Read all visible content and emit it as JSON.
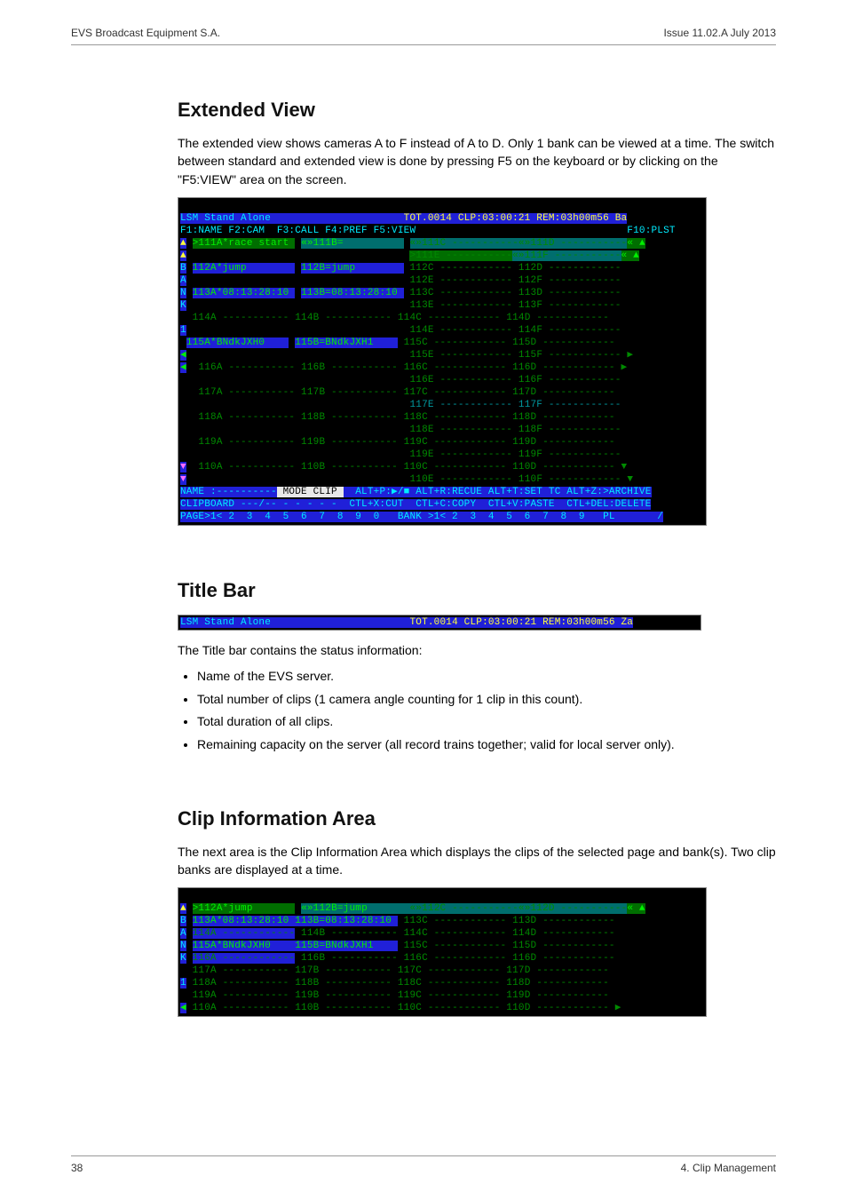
{
  "header": {
    "left": "EVS Broadcast Equipment S.A.",
    "right": "Issue 11.02.A July 2013"
  },
  "section1": {
    "title": "Extended View",
    "para": "The extended view shows cameras A to F instead of A to D. Only 1 bank can be viewed at a time. The switch between standard and extended view is done by pressing F5 on the keyboard or by clicking on the \"F5:VIEW\" area on the screen."
  },
  "terminal1": {
    "l1_left": "LSM Stand Alone",
    "l1_right": "TOT.0014 CLP:03:00:21 REM:03h00m56 Ba",
    "l2_left": "F1:NAME F2:CAM  F3:CALL F4:PREF F5:VIEW",
    "l2_right": "F10:PLST",
    "gutter": [
      "▲",
      "▲",
      "B",
      "A",
      "N",
      "K",
      "",
      "1",
      "",
      "◀",
      "◀",
      "",
      "",
      "",
      "",
      "",
      "",
      "",
      "▼",
      "▼"
    ],
    "row1": {
      "a": ">111A*race start ",
      "b": "«»111B=          ",
      "c": "«»111C -----------",
      "d": "«»111D -----------",
      "tail": "« ▲"
    },
    "row1b": {
      "a": "                 ",
      "b": "                 ",
      "c": ">111E -----------",
      "d": "«»111F -----------",
      "tail": "« ▲"
    },
    "r2": {
      "a": "112A*jump        ",
      "b": "112B=jump        ",
      "c": "112C ------------",
      "d": " 112D ------------"
    },
    "r2b": {
      "a": "                 ",
      "b": "                 ",
      "c": "112E ------------",
      "d": " 112F ------------"
    },
    "r3": {
      "a": "113A*08:13:28:10 ",
      "b": "113B=08:13:28:10 ",
      "c": "113C ------------",
      "d": " 113D ------------"
    },
    "r3b": {
      "a": "                 ",
      "b": "                 ",
      "c": "113E ------------",
      "d": " 113F ------------"
    },
    "r4": {
      "a": " 114A -----------",
      "b": " 114B -----------",
      "c": " 114C ------------",
      "d": " 114D ------------"
    },
    "r4b": {
      "a": "                 ",
      "b": "                 ",
      "c": " 114E ------------",
      "d": " 114F ------------"
    },
    "r5": {
      "a": "115A*BNdkJXH0    ",
      "b": "115B=BNdkJXH1    ",
      "c": " 115C ------------",
      "d": " 115D ------------"
    },
    "r5b": {
      "a": "                 ",
      "b": "                 ",
      "c": " 115E ------------",
      "d": " 115F ------------ ▶"
    },
    "r6": {
      "a": " 116A -----------",
      "b": " 116B -----------",
      "c": " 116C ------------",
      "d": " 116D ------------ ▶"
    },
    "r6b": {
      "a": "                 ",
      "b": "                 ",
      "c": " 116E ------------",
      "d": " 116F ------------"
    },
    "r7": {
      "a": " 117A -----------",
      "b": " 117B -----------",
      "c": " 117C ------------",
      "d": " 117D ------------"
    },
    "r7b": {
      "a": "                 ",
      "b": "                 ",
      "c": " 117E ------------",
      "d": " 117F ------------"
    },
    "r8": {
      "a": " 118A -----------",
      "b": " 118B -----------",
      "c": " 118C ------------",
      "d": " 118D ------------"
    },
    "r8b": {
      "a": "                 ",
      "b": "                 ",
      "c": " 118E ------------",
      "d": " 118F ------------"
    },
    "r9": {
      "a": " 119A -----------",
      "b": " 119B -----------",
      "c": " 119C ------------",
      "d": " 119D ------------"
    },
    "r9b": {
      "a": "                 ",
      "b": "                 ",
      "c": " 119E ------------",
      "d": " 119F ------------"
    },
    "r10": {
      "a": " 110A -----------",
      "b": " 110B -----------",
      "c": " 110C ------------",
      "d": " 110D ------------ ▼"
    },
    "r10b": {
      "a": "                 ",
      "b": "                 ",
      "c": " 110E ------------",
      "d": " 110F ------------ ▼"
    },
    "namebar": {
      "name": "NAME :----------",
      "mode": " MODE CLIP ",
      "rest": "  ALT+P:▶/■ ALT+R:RECUE ALT+T:SET TC ALT+Z:>ARCHIVE"
    },
    "clipboard": "CLIPBOARD ---/-- - - - - -  CTL+X:CUT  CTL+C:COPY  CTL+V:PASTE  CTL+DEL:DELETE",
    "pagebar": "PAGE>1< 2  3  4  5  6  7  8  9  0   BANK >1< 2  3  4  5  6  7  8  9   PL       /"
  },
  "section2": {
    "title": "Title Bar",
    "tbar_left": "LSM Stand Alone",
    "tbar_right": "TOT.0014 CLP:03:00:21 REM:03h00m56 Za",
    "intro": "The Title bar contains the status information:",
    "items": [
      "Name of the EVS server.",
      "Total number of clips (1 camera angle counting for 1 clip in this count).",
      "Total duration of all clips.",
      "Remaining capacity on the server (all record trains together; valid for local server only)."
    ]
  },
  "section3": {
    "title": "Clip Information Area",
    "para": "The next area is the Clip Information Area which displays the clips of the selected page and bank(s). Two clip banks are displayed at a time."
  },
  "terminal2": {
    "gutter": [
      "▲",
      "B",
      "A",
      "N",
      "K",
      "",
      "1",
      "",
      "◀"
    ],
    "r1": {
      "a": ">112A*jump       ",
      "b": "«»112B=jump       ",
      "c": "«»112C -----------",
      "d": "«»112D -----------",
      "tail": "« ▲"
    },
    "r2": {
      "a": "113A*08:13:28:10 ",
      "b": "113B=08:13:28:10 ",
      "c": " 113C ------------",
      "d": " 113D ------------"
    },
    "r3": {
      "a": "114A ------------",
      "b": " 114B -----------",
      "c": " 114C ------------",
      "d": " 114D ------------"
    },
    "r4": {
      "a": "115A*BNdkJXH0    ",
      "b": "115B=BNdkJXH1    ",
      "c": " 115C ------------",
      "d": " 115D ------------"
    },
    "r5": {
      "a": "116A ------------",
      "b": " 116B -----------",
      "c": " 116C ------------",
      "d": " 116D ------------"
    },
    "r6": {
      "a": " 117A -----------",
      "b": " 117B -----------",
      "c": " 117C ------------",
      "d": " 117D ------------"
    },
    "r7": {
      "a": " 118A -----------",
      "b": " 118B -----------",
      "c": " 118C ------------",
      "d": " 118D ------------"
    },
    "r8": {
      "a": " 119A -----------",
      "b": " 119B -----------",
      "c": " 119C ------------",
      "d": " 119D ------------"
    },
    "r9": {
      "a": " 110A -----------",
      "b": " 110B -----------",
      "c": " 110C ------------",
      "d": " 110D ------------ ▶"
    }
  },
  "footer": {
    "left": "38",
    "right": "4. Clip Management"
  }
}
